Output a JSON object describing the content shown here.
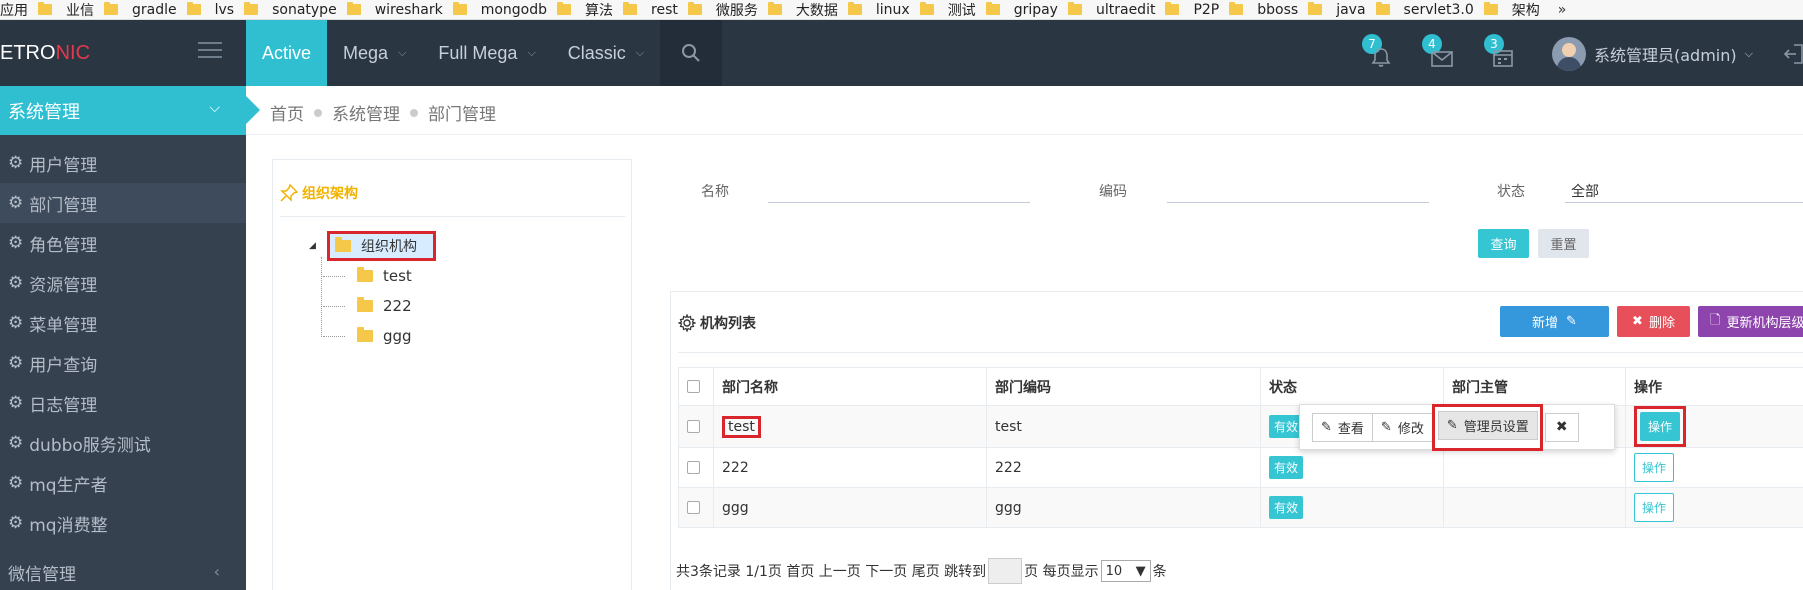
{
  "bookmarks": {
    "items": [
      "应用",
      "业信",
      "gradle",
      "lvs",
      "sonatype",
      "wireshark",
      "mongodb",
      "算法",
      "rest",
      "微服务",
      "大数据",
      "linux",
      "测试",
      "gripay",
      "ultraedit",
      "P2P",
      "bboss",
      "java",
      "servlet3.0",
      "架构"
    ],
    "more": "»"
  },
  "header": {
    "logo_part1": "ETRO",
    "logo_part2": "NIC",
    "nav": [
      {
        "label": "Active"
      },
      {
        "label": "Mega"
      },
      {
        "label": "Full Mega"
      },
      {
        "label": "Classic"
      }
    ],
    "badges": {
      "bell": "7",
      "mail": "4",
      "calendar": "3"
    },
    "user_name": "系统管理员(admin)"
  },
  "sidebar": {
    "section": "系统管理",
    "items": [
      "用户管理",
      "部门管理",
      "角色管理",
      "资源管理",
      "菜单管理",
      "用户查询",
      "日志管理",
      "dubbo服务测试",
      "mq生产者",
      "mq消费整"
    ],
    "bottom": "微信管理"
  },
  "breadcrumb": [
    "首页",
    "系统管理",
    "部门管理"
  ],
  "tree": {
    "title": "组织架构",
    "root": "组织机构",
    "children": [
      "test",
      "222",
      "ggg"
    ]
  },
  "filter": {
    "name_label": "名称",
    "code_label": "编码",
    "status_label": "状态",
    "status_value": "全部",
    "query_button": "查询",
    "reset_button": "重置"
  },
  "list": {
    "title": "机构列表",
    "add_button": "新增",
    "delete_button": "删除",
    "update_button": "更新机构层级关系",
    "columns": [
      "部门名称",
      "部门编码",
      "状态",
      "部门主管",
      "操作"
    ],
    "rows": [
      {
        "name": "test",
        "code": "test",
        "status": "有效",
        "manager": "",
        "action": "操作"
      },
      {
        "name": "222",
        "code": "222",
        "status": "有效",
        "manager": "",
        "action": "操作"
      },
      {
        "name": "ggg",
        "code": "ggg",
        "status": "有效",
        "manager": "",
        "action": "操作"
      }
    ]
  },
  "popover": {
    "view": "查看",
    "edit": "修改",
    "admin_settings": "管理员设置"
  },
  "pager": {
    "summary": "共3条记录 1/1页 首页 上一页 下一页 尾页 跳转到",
    "page_suffix": "页 每页显示",
    "page_size": "10",
    "unit": "条"
  },
  "colors": {
    "accent": "#36c6d3",
    "header_bg": "#2b3643",
    "sidebar_bg": "#364150",
    "danger": "#e7505a",
    "primary": "#3598dc",
    "purple": "#8e44ad",
    "highlight_box": "#d9262c"
  }
}
